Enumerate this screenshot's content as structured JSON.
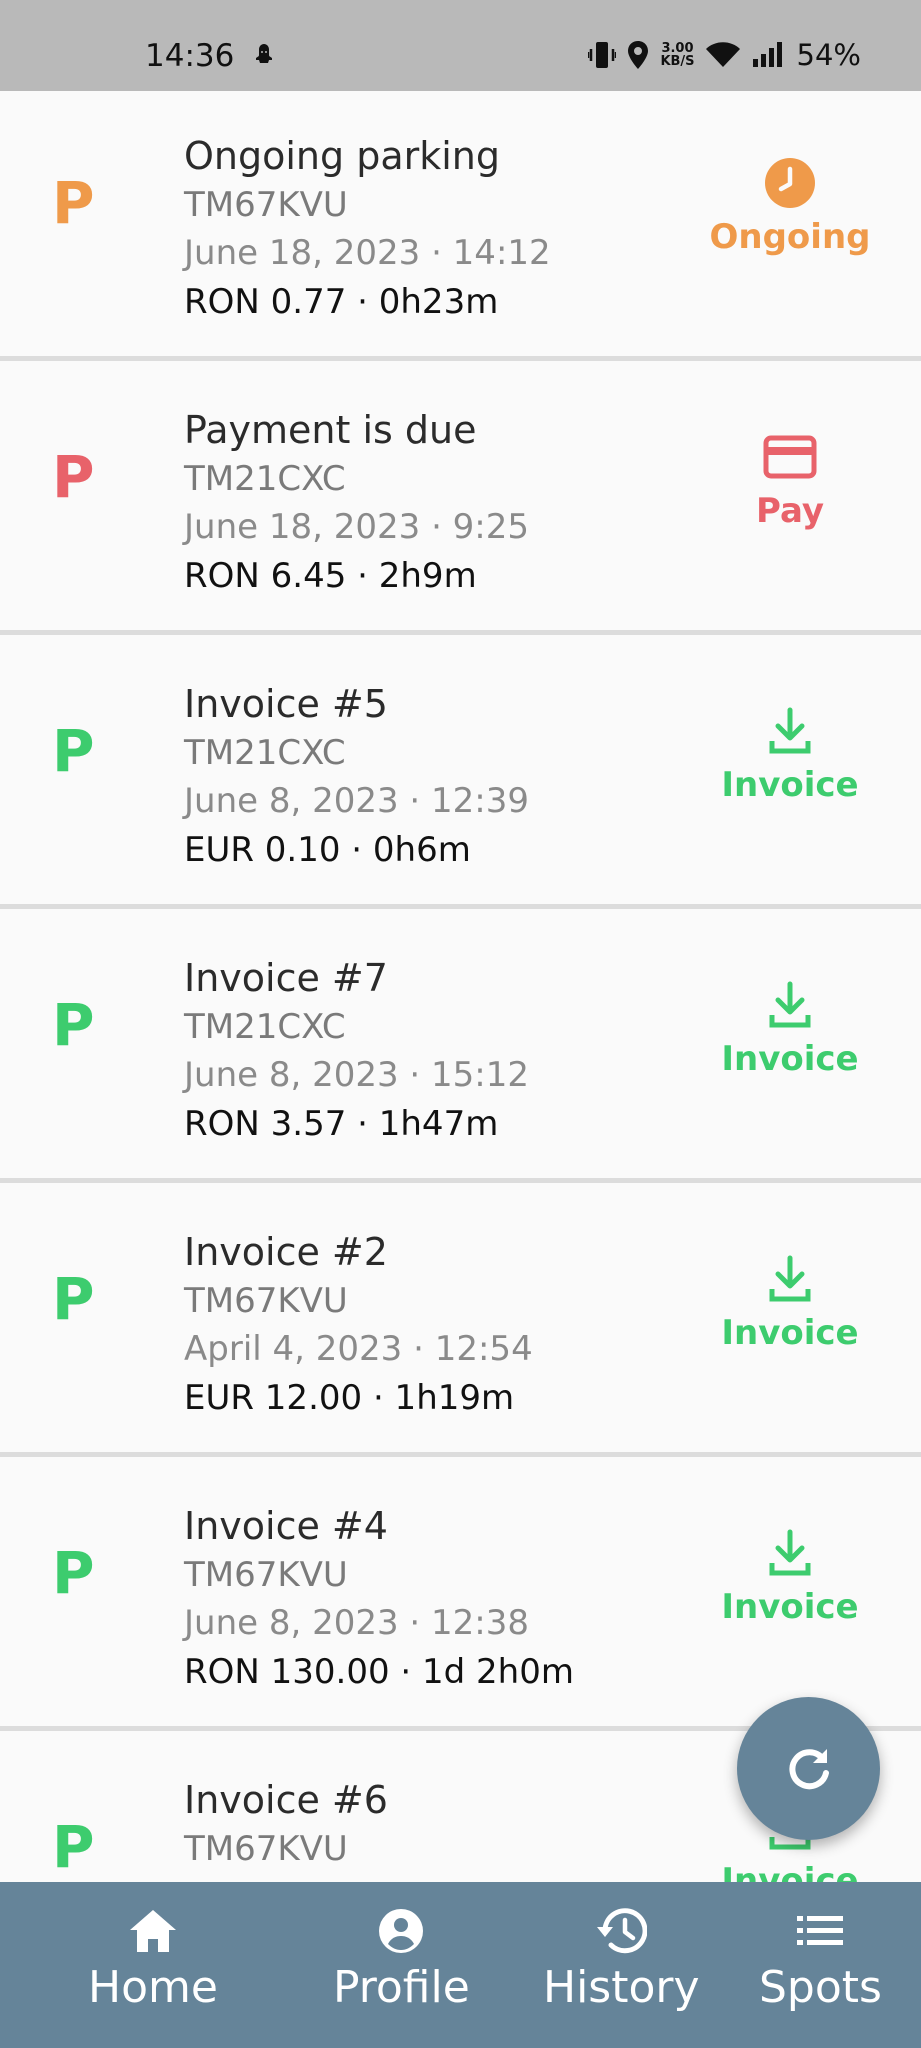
{
  "status_bar": {
    "time": "14:36",
    "speed_value": "3.00",
    "speed_unit": "KB/S",
    "battery": "54%"
  },
  "rows": [
    {
      "letter": "P",
      "title": "Ongoing parking",
      "plate": "TM67KVU",
      "date": "June 18, 2023 · 14:12",
      "amount": "RON 0.77 · 0h23m",
      "action": "Ongoing",
      "status_color": "#ef9a4a",
      "icon": "clock-icon"
    },
    {
      "letter": "P",
      "title": "Payment is due",
      "plate": "TM21CXC",
      "date": "June 18, 2023 · 9:25",
      "amount": "RON 6.45 · 2h9m",
      "action": "Pay",
      "status_color": "#e8626a",
      "icon": "credit-card-icon"
    },
    {
      "letter": "P",
      "title": "Invoice #5",
      "plate": "TM21CXC",
      "date": "June 8, 2023 · 12:39",
      "amount": "EUR 0.10 · 0h6m",
      "action": "Invoice",
      "status_color": "#3dcc6e",
      "icon": "download-icon"
    },
    {
      "letter": "P",
      "title": "Invoice #7",
      "plate": "TM21CXC",
      "date": "June 8, 2023 · 15:12",
      "amount": "RON 3.57 · 1h47m",
      "action": "Invoice",
      "status_color": "#3dcc6e",
      "icon": "download-icon"
    },
    {
      "letter": "P",
      "title": "Invoice #2",
      "plate": "TM67KVU",
      "date": "April 4, 2023 · 12:54",
      "amount": "EUR 12.00 · 1h19m",
      "action": "Invoice",
      "status_color": "#3dcc6e",
      "icon": "download-icon"
    },
    {
      "letter": "P",
      "title": "Invoice #4",
      "plate": "TM67KVU",
      "date": "June 8, 2023 · 12:38",
      "amount": "RON 130.00 · 1d 2h0m",
      "action": "Invoice",
      "status_color": "#3dcc6e",
      "icon": "download-icon"
    },
    {
      "letter": "P",
      "title": "Invoice #6",
      "plate": "TM67KVU",
      "date": "",
      "amount": "",
      "action": "Invoice",
      "status_color": "#3dcc6e",
      "icon": "download-icon"
    }
  ],
  "fab": {
    "icon": "refresh-icon"
  },
  "nav": {
    "home": "Home",
    "profile": "Profile",
    "history": "History",
    "spots": "Spots"
  },
  "colors": {
    "header": "#b9b9b9",
    "nav": "#658499",
    "ongoing": "#ef9a4a",
    "due": "#e8626a",
    "paid": "#3dcc6e"
  }
}
